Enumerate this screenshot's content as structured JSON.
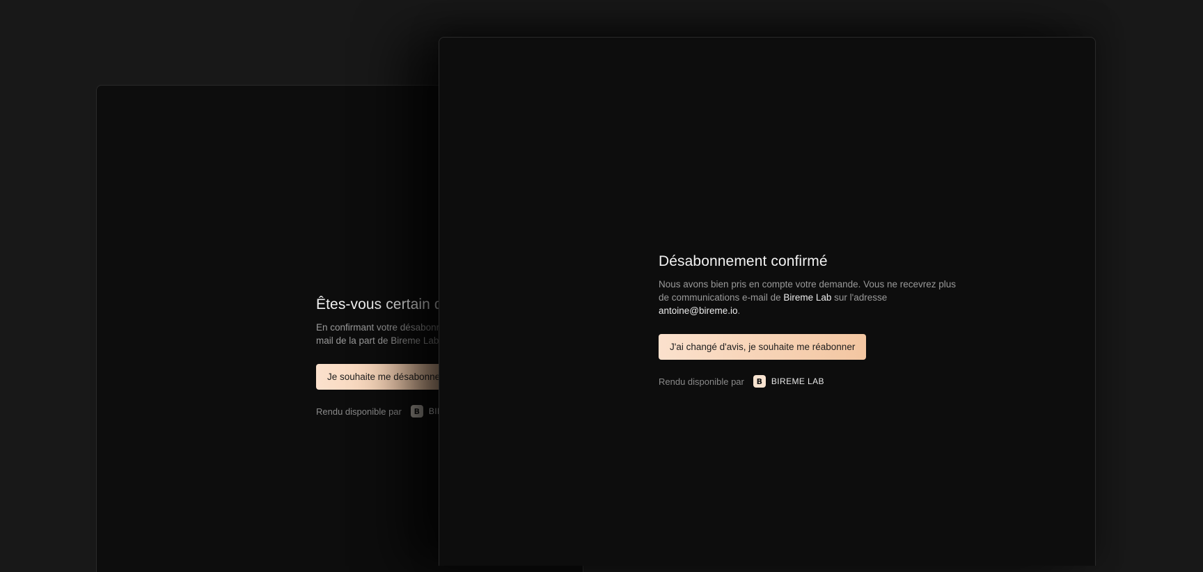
{
  "background_panel": {
    "title": "Êtes-vous certain de vouloir vous désabonner ?",
    "description": "En confirmant votre désabonnement, vous ne recevrez plus aucune communication e-mail de la part de Bireme Lab.",
    "cta_label": "Je souhaite me désabonner",
    "powered_by_label": "Rendu disponible par",
    "brand_logo_letter": "B",
    "brand_name": "BIREME LAB"
  },
  "foreground_panel": {
    "title": "Désabonnement confirmé",
    "description": {
      "part1": "Nous avons bien pris en compte votre demande. Vous ne recevrez plus de communications e-mail de ",
      "company": "Bireme Lab",
      "part2": " sur l'adresse ",
      "email": "antoine@bireme.io",
      "part3": "."
    },
    "cta_label": "J'ai changé d'avis, je souhaite me réabonner",
    "powered_by_label": "Rendu disponible par",
    "brand_logo_letter": "B",
    "brand_name": "BIREME LAB"
  },
  "colors": {
    "page_background": "#181818",
    "panel_background": "#0d0d0d",
    "accent_gradient_start": "#fbe1cd",
    "accent_gradient_end": "#f3c6a1"
  },
  "icons": {
    "brand_logo": "bireme-lab-logo-icon"
  }
}
